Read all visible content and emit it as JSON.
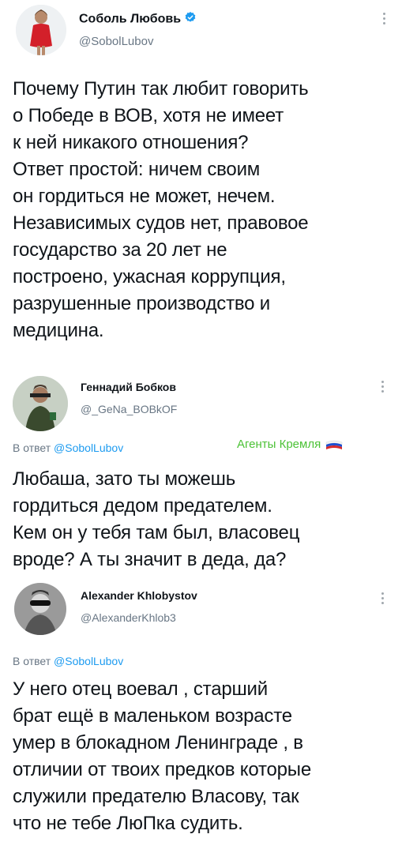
{
  "tweet1": {
    "name": "Соболь Любовь",
    "handle": "@SobolLubov",
    "text": "Почему Путин так любит говорить\nо Победе в ВОВ, хотя не имеет\nк ней никакого отношения?\nОтвет простой: ничем своим\nон гордиться не может, нечем.\nНезависимых судов нет, правовое\nгосударство за 20 лет не\nпостроено, ужасная коррупция,\nразрушенные производство и\nмедицина.",
    "verified_icon": "verified-badge-icon",
    "more_icon": "more-vertical-icon"
  },
  "tweet2": {
    "name": "Геннадий Бобков",
    "handle": "@_GeNa_BOBkOF",
    "reply_prefix": "В ответ ",
    "reply_mention": "@SobolLubov",
    "tag": "Агенты Кремля",
    "tag_icon": "russian-flag-icon",
    "text": "Любаша, зато ты можешь\nгордиться дедом предателем.\nКем он у тебя там был, власовец\nвроде? А ты значит в деда, да?",
    "more_icon": "more-vertical-icon"
  },
  "tweet3": {
    "name": "Alexander Khlobystov",
    "handle": "@AlexanderKhlob3",
    "reply_prefix": "В ответ ",
    "reply_mention": "@SobolLubov",
    "text": "У него отец воевал , старший\nбрат ещё в маленьком возрасте\nумер в блокадном Ленинграде , в\nотличии от твоих предков которые\nслужили предателю Власову, так\nчто не тебе ЛюПка судить.",
    "more_icon": "more-vertical-icon"
  },
  "colors": {
    "link": "#1d9bf0",
    "muted": "#687684",
    "tag_green": "#4cc236",
    "text": "#0f1419"
  }
}
